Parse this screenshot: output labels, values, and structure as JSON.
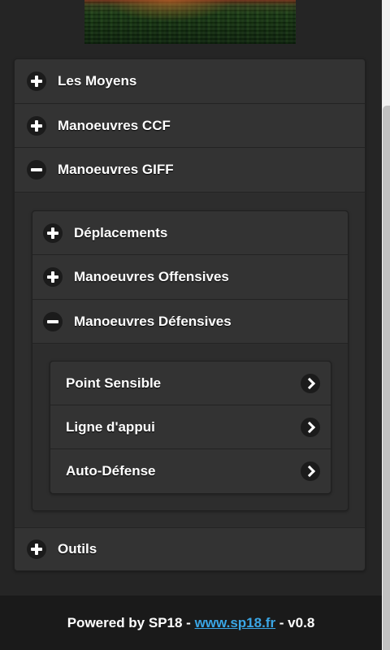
{
  "menu": {
    "items": [
      {
        "label": "Les Moyens",
        "state": "collapsed"
      },
      {
        "label": "Manoeuvres CCF",
        "state": "collapsed"
      },
      {
        "label": "Manoeuvres GIFF",
        "state": "expanded"
      },
      {
        "label": "Outils",
        "state": "collapsed"
      }
    ]
  },
  "giff": {
    "items": [
      {
        "label": "Déplacements",
        "state": "collapsed"
      },
      {
        "label": "Manoeuvres Offensives",
        "state": "collapsed"
      },
      {
        "label": "Manoeuvres Défensives",
        "state": "expanded"
      }
    ]
  },
  "defensives": {
    "items": [
      {
        "label": "Point Sensible"
      },
      {
        "label": "Ligne d'appui"
      },
      {
        "label": "Auto-Défense"
      }
    ]
  },
  "footer": {
    "prefix": "Powered by SP18 - ",
    "link": "www.sp18.fr",
    "suffix": " - v0.8"
  },
  "colors": {
    "background": "#252525",
    "row": "#333333",
    "link": "#3aa6e6",
    "footer": "#1a1a1a"
  },
  "icons": {
    "collapsed": "plus-icon",
    "expanded": "minus-icon",
    "item": "chevron-right-icon"
  }
}
